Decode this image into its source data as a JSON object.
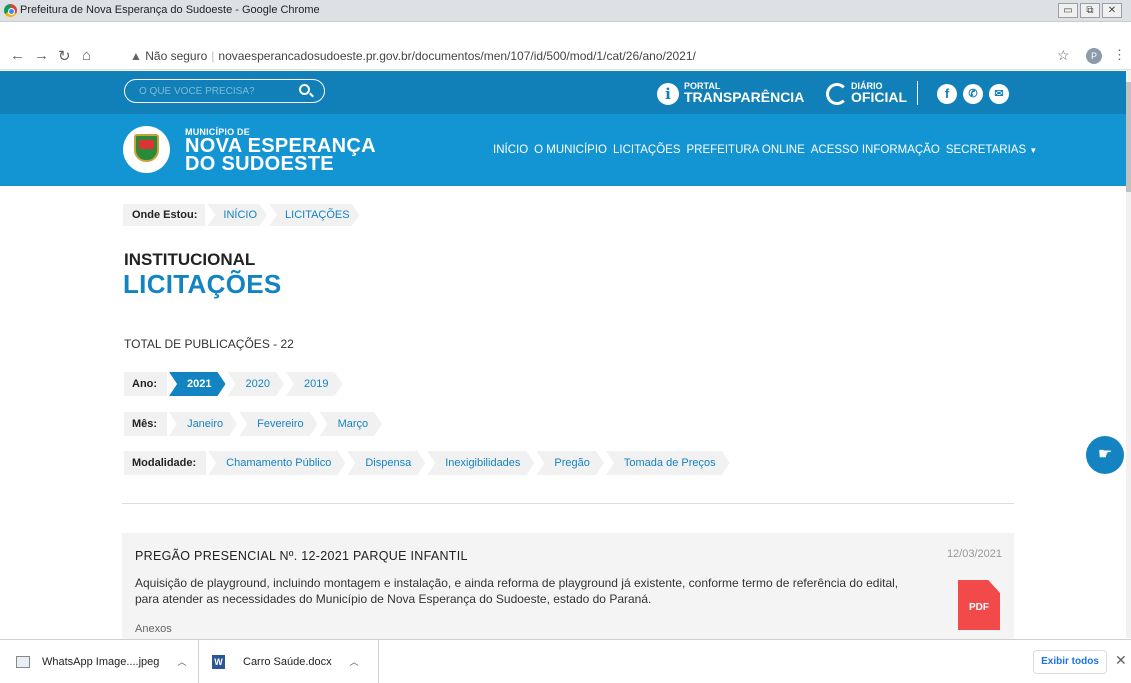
{
  "browser": {
    "window_title": "Prefeitura de Nova Esperança do Sudoeste - Google Chrome",
    "security_label": "Não seguro",
    "url": "novaesperancadosudoeste.pr.gov.br/documentos/men/107/id/500/mod/1/cat/26/ano/2021/",
    "profile_initial": "P"
  },
  "topbar": {
    "search_placeholder": "O QUE VOCÊ PRECISA?",
    "portal_l1": "PORTAL",
    "portal_l2": "TRANSPARÊNCIA",
    "diario_l1": "DIÁRIO",
    "diario_l2": "OFICIAL"
  },
  "header": {
    "logo_muni": "MUNICÍPIO DE",
    "logo_name_1": "NOVA ESPERANÇA",
    "logo_name_2": "DO SUDOESTE",
    "nav": [
      "INÍCIO",
      "O MUNICÍPIO",
      "LICITAÇÕES",
      "PREFEITURA ONLINE",
      "ACESSO INFORMAÇÃO",
      "SECRETARIAS"
    ]
  },
  "breadcrumb": {
    "label": "Onde Estou:",
    "items": [
      "INÍCIO",
      "LICITAÇÕES"
    ]
  },
  "page": {
    "kicker": "INSTITUCIONAL",
    "title": "LICITAÇÕES",
    "total": "TOTAL DE PUBLICAÇÕES - 22"
  },
  "filters": {
    "ano_label": "Ano:",
    "anos": [
      "2021",
      "2020",
      "2019"
    ],
    "mes_label": "Mês:",
    "meses": [
      "Janeiro",
      "Fevereiro",
      "Março"
    ],
    "modalidade_label": "Modalidade:",
    "modalidades": [
      "Chamamento Público",
      "Dispensa",
      "Inexigibilidades",
      "Pregão",
      "Tomada de Preços"
    ]
  },
  "publication": {
    "title": "PREGÃO PRESENCIAL Nº. 12-2021 PARQUE INFANTIL",
    "date": "12/03/2021",
    "description": "Aquisição de playground, incluindo montagem e instalação, e ainda reforma de playground já existente, conforme termo de referência do edital, para atender as necessidades do Município de Nova Esperança do Sudoeste, estado do Paraná.",
    "anexos_label": "Anexos",
    "pdf_label": "PDF"
  },
  "downloads": {
    "items": [
      "WhatsApp Image....jpeg",
      "Carro Saúde.docx"
    ],
    "show_all": "Exibir todos"
  }
}
